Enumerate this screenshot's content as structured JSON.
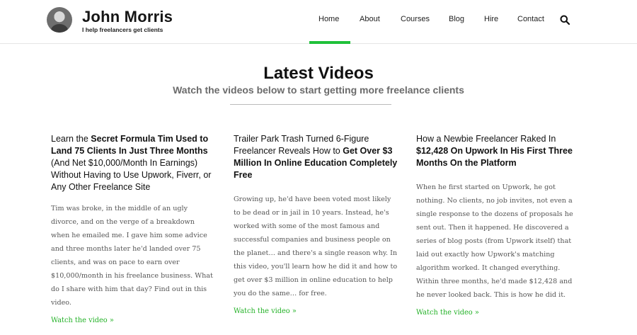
{
  "header": {
    "name": "John Morris",
    "tagline": "I help freelancers get clients",
    "nav": [
      {
        "label": "Home"
      },
      {
        "label": "About"
      },
      {
        "label": "Courses"
      },
      {
        "label": "Blog"
      },
      {
        "label": "Hire"
      },
      {
        "label": "Contact"
      }
    ],
    "active_nav": "Home",
    "accent_color": "#1fc13a",
    "search_icon": "search-icon"
  },
  "section": {
    "title": "Latest Videos",
    "subtitle": "Watch the videos below to start getting more freelance clients"
  },
  "cards": [
    {
      "title_parts": [
        "Learn the ",
        "Secret Formula Tim Used to Land 75 Clients In Just Three Months",
        " (And Net $10,000/Month In Earnings) Without Having to Use Upwork, Fiverr, or Any Other Freelance Site"
      ],
      "body": "Tim was broke, in the middle of an ugly divorce, and on the verge of a breakdown when he emailed me. I gave him some advice and three months later he'd landed over 75 clients, and was on pace to earn over $10,000/month in his freelance business. What do I share with him that day? Find out in this video.",
      "link": "Watch the video »"
    },
    {
      "title_parts": [
        "Trailer Park Trash Turned 6-Figure Freelancer Reveals How to ",
        "Get Over $3 Million In Online Education Completely Free",
        ""
      ],
      "body": "Growing up, he'd have been voted most likely to be dead or in jail in 10 years. Instead, he's worked with some of the most famous and successful companies and business people on the planet… and there's a single reason why. In this video, you'll learn how he did it and how to get over $3 million in online education to help you do the same… for free.",
      "link": "Watch the video »"
    },
    {
      "title_parts": [
        "How a Newbie Freelancer Raked In ",
        "$12,428 On Upwork In His First Three Months On the Platform",
        ""
      ],
      "body": "When he first started on Upwork, he got nothing. No clients, no job invites, not even a single response to the dozens of proposals he sent out. Then it happened. He discovered a series of blog posts (from Upwork itself) that laid out exactly how Upwork's matching algorithm worked. It changed everything. Within three months, he'd made $12,428 and he never looked back. This is how he did it.",
      "link": "Watch the video »"
    }
  ]
}
